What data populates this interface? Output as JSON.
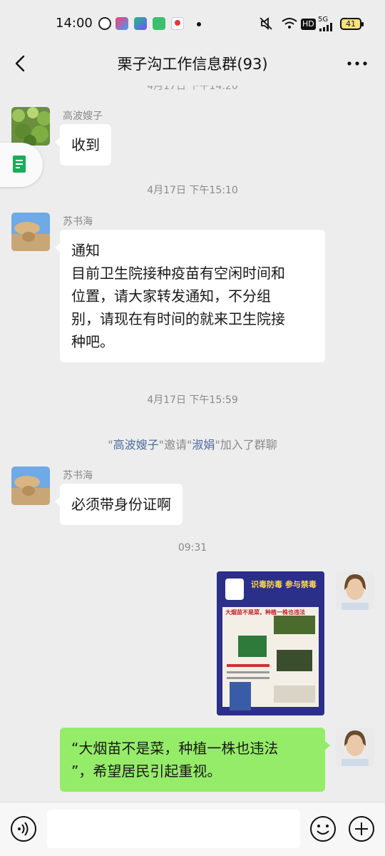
{
  "status_bar": {
    "time": "14:00",
    "network": "5G",
    "hd": "HD",
    "battery": "41"
  },
  "header": {
    "title": "栗子沟工作信息群(93)"
  },
  "chat": {
    "partial_time": "4月17日 下午14:20",
    "messages": [
      {
        "sender": "高波嫂子",
        "text": "收到"
      },
      {
        "timestamp": "4月17日 下午15:10"
      },
      {
        "sender": "苏书海",
        "lines": [
          "通知",
          "目前卫生院接种疫苗有空闲时间和",
          "位置，请大家转发通知，不分组",
          "别，请现在有时间的就来卫生院接",
          "种吧。"
        ]
      },
      {
        "timestamp": "4月17日 下午15:59"
      },
      {
        "system": {
          "prefix": "\"",
          "inviter": "高波嫂子",
          "mid": "\"邀请\"",
          "invitee": "淑娟",
          "suffix": "\"加入了群聊"
        }
      },
      {
        "sender": "苏书海",
        "text": "必须带身份证啊"
      },
      {
        "timestamp": "09:31"
      },
      {
        "poster": {
          "title": "识毒防毒 参与禁毒",
          "headline": "大烟苗不是菜，种植一株也违法"
        }
      },
      {
        "mine_lines": [
          "“大烟苗不是菜，种植一株也违法",
          "”，希望居民引起重视。"
        ]
      }
    ]
  },
  "input_bar": {
    "placeholder": ""
  },
  "colors": {
    "background": "#ededed",
    "mine_bubble": "#95ec69",
    "name_link": "#4f6b9a"
  }
}
